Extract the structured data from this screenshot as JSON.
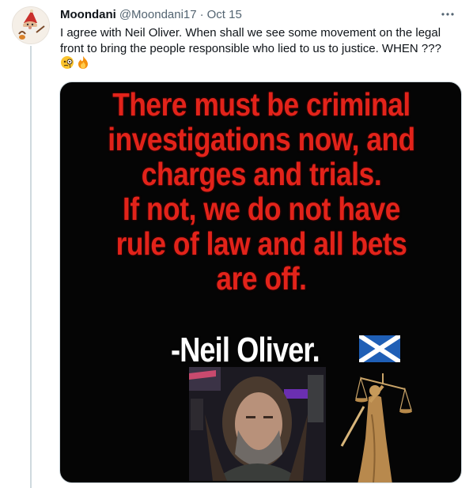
{
  "tweet": {
    "display_name": "Moondani",
    "handle": "@Moondani17",
    "separator": "·",
    "date": "Oct 15",
    "more_icon": "more-horizontal-icon",
    "text": "I agree with Neil Oliver. When shall we see some movement on the legal front to bring the people responsible who lied to us to justice. WHEN ???",
    "emojis": [
      "face-with-monocle-emoji",
      "fire-emoji"
    ]
  },
  "media": {
    "quote_lines": [
      "There must be criminal",
      "investigations now, and",
      "charges and trials.",
      "If not, we do not have",
      "rule of law and all bets",
      "are off."
    ],
    "attribution": "-Neil Oliver.",
    "flag_icon": "scotland-flag-icon",
    "statue_icon": "lady-justice-statue",
    "colors": {
      "quote": "#e2231a",
      "attribution": "#ffffff",
      "background": "#050505",
      "flag_blue": "#1f5fb6"
    }
  }
}
